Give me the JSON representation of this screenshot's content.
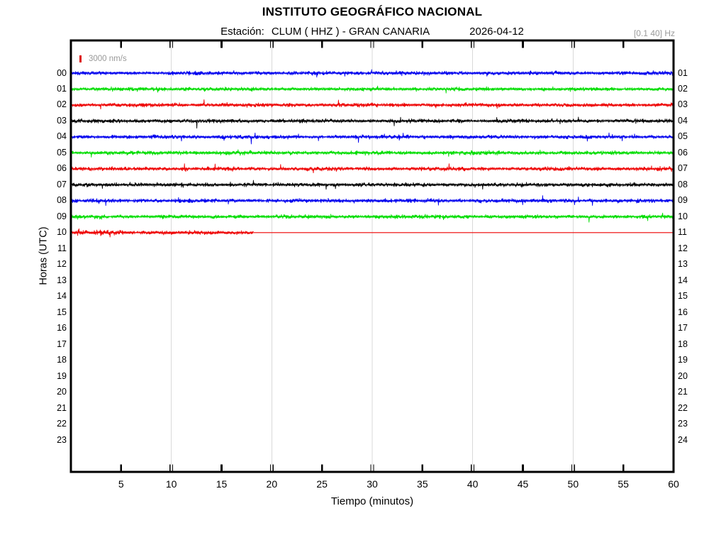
{
  "header": {
    "title": "INSTITUTO GEOGRÁFICO NACIONAL",
    "station_label": "Estación:",
    "station": "CLUM ( HHZ ) - GRAN CANARIA",
    "date": "2026-04-12",
    "filter_band": "[0.1 40] Hz"
  },
  "legend": {
    "scale_label": "3000 nm/s",
    "tick_color": "#dd1111"
  },
  "axes": {
    "x_label": "Tiempo (minutos)",
    "y_label": "Horas (UTC)",
    "x_tick_labels": [
      "5",
      "10",
      "15",
      "20",
      "25",
      "30",
      "35",
      "40",
      "45",
      "50",
      "55",
      "60"
    ],
    "left_hour_labels": [
      "00",
      "01",
      "02",
      "03",
      "04",
      "05",
      "06",
      "07",
      "08",
      "09",
      "10",
      "11",
      "12",
      "13",
      "14",
      "15",
      "16",
      "17",
      "18",
      "19",
      "20",
      "21",
      "22",
      "23"
    ],
    "right_hour_labels": [
      "01",
      "02",
      "03",
      "04",
      "05",
      "06",
      "07",
      "08",
      "09",
      "10",
      "11",
      "12",
      "13",
      "14",
      "15",
      "16",
      "17",
      "18",
      "19",
      "20",
      "21",
      "22",
      "23",
      "24"
    ]
  },
  "chart_data": {
    "type": "line",
    "variant": "helicorder-seismogram",
    "title": "INSTITUTO GEOGRÁFICO NACIONAL",
    "subtitle": "Estación: CLUM ( HHZ ) - GRAN CANARIA 2026-04-12",
    "station": "CLUM",
    "channel": "HHZ",
    "location": "GRAN CANARIA",
    "date": "2026-04-12",
    "filter_band_hz": [
      0.1,
      40
    ],
    "amplitude_scale": "3000 nm/s",
    "xlabel": "Tiempo (minutos)",
    "ylabel": "Horas (UTC)",
    "x_range_minutes": [
      0,
      60
    ],
    "x_ticks_minutes": [
      5,
      10,
      15,
      20,
      25,
      30,
      35,
      40,
      45,
      50,
      55,
      60
    ],
    "grid_minutes": [
      10,
      20,
      30,
      40,
      50
    ],
    "color_cycle": [
      "#0000ee",
      "#00dd00",
      "#ee0000",
      "#000000"
    ],
    "rows": [
      {
        "hour_utc": "00",
        "color": "#0000ee",
        "signal_minutes": [
          0,
          60
        ],
        "content": "continuous background noise"
      },
      {
        "hour_utc": "01",
        "color": "#00dd00",
        "signal_minutes": [
          0,
          60
        ],
        "content": "continuous background noise"
      },
      {
        "hour_utc": "02",
        "color": "#ee0000",
        "signal_minutes": [
          0,
          60
        ],
        "content": "continuous background noise"
      },
      {
        "hour_utc": "03",
        "color": "#000000",
        "signal_minutes": [
          0,
          60
        ],
        "content": "continuous background noise"
      },
      {
        "hour_utc": "04",
        "color": "#0000ee",
        "signal_minutes": [
          0,
          60
        ],
        "content": "continuous background noise"
      },
      {
        "hour_utc": "05",
        "color": "#00dd00",
        "signal_minutes": [
          0,
          60
        ],
        "content": "continuous background noise"
      },
      {
        "hour_utc": "06",
        "color": "#ee0000",
        "signal_minutes": [
          0,
          60
        ],
        "content": "continuous background noise"
      },
      {
        "hour_utc": "07",
        "color": "#000000",
        "signal_minutes": [
          0,
          60
        ],
        "content": "continuous background noise"
      },
      {
        "hour_utc": "08",
        "color": "#0000ee",
        "signal_minutes": [
          0,
          60
        ],
        "content": "continuous background noise"
      },
      {
        "hour_utc": "09",
        "color": "#00dd00",
        "signal_minutes": [
          0,
          60
        ],
        "content": "continuous background noise"
      },
      {
        "hour_utc": "10",
        "color": "#ee0000",
        "signal_minutes": [
          0,
          18.2
        ],
        "flat_line_minutes": [
          18.2,
          60
        ],
        "content": "noise until ~minute 18, flat line afterwards (current hour)"
      }
    ],
    "empty_hours": [
      "11",
      "12",
      "13",
      "14",
      "15",
      "16",
      "17",
      "18",
      "19",
      "20",
      "21",
      "22",
      "23"
    ]
  }
}
